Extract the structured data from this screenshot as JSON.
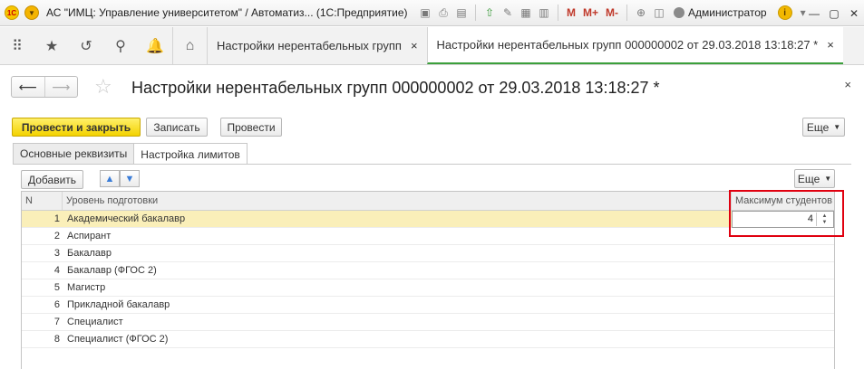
{
  "titlebar": {
    "logo": "1С",
    "title": "АС \"ИМЦ: Управление университетом\" / Автоматиз... (1С:Предприятие)",
    "m_buttons": [
      "M",
      "M+",
      "M-"
    ],
    "user": "Администратор",
    "info": "i"
  },
  "nav": {
    "tabs": [
      {
        "label": "Настройки нерентабельных групп"
      },
      {
        "label": "Настройки нерентабельных групп 000000002 от 29.03.2018 13:18:27 *"
      }
    ],
    "close_glyph": "×"
  },
  "form": {
    "title": "Настройки нерентабельных групп 000000002 от 29.03.2018 13:18:27 *",
    "buttons": {
      "post_and_close": "Провести и закрыть",
      "save": "Записать",
      "post": "Провести",
      "more": "Еще"
    },
    "tabs": [
      "Основные реквизиты",
      "Настройка лимитов"
    ],
    "table_toolbar": {
      "add": "Добавить",
      "more": "Еще"
    },
    "table": {
      "columns": [
        "N",
        "Уровень подготовки",
        "Максимум студентов"
      ],
      "rows": [
        {
          "n": "1",
          "level": "Академический бакалавр",
          "max": "4"
        },
        {
          "n": "2",
          "level": "Аспирант",
          "max": ""
        },
        {
          "n": "3",
          "level": "Бакалавр",
          "max": ""
        },
        {
          "n": "4",
          "level": "Бакалавр (ФГОС 2)",
          "max": ""
        },
        {
          "n": "5",
          "level": "Магистр",
          "max": ""
        },
        {
          "n": "6",
          "level": "Прикладной бакалавр",
          "max": ""
        },
        {
          "n": "7",
          "level": "Специалист",
          "max": ""
        },
        {
          "n": "8",
          "level": "Специалист (ФГОС 2)",
          "max": ""
        }
      ]
    }
  },
  "colors": {
    "primary_button": "#f3d200",
    "selected_row": "#faefb9",
    "highlight_border": "#e0000f",
    "active_tab_underline": "#3ca03c"
  }
}
